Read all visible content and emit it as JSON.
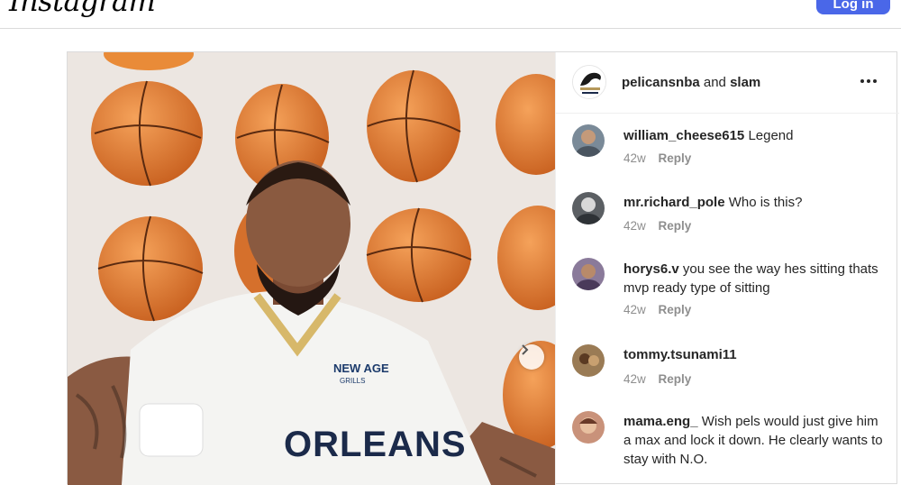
{
  "header": {
    "logo_text": "Instagram",
    "login_label": "Log in"
  },
  "post": {
    "author_a": "pelicansnba",
    "joiner": "and",
    "author_b": "slam",
    "photo": {
      "jersey_text": "ORLEANS",
      "sponsor_line1": "NEW AGE",
      "sponsor_line2": "GRILLS"
    },
    "comments": [
      {
        "user": "william_cheese615",
        "text": "Legend",
        "age": "42w",
        "reply": "Reply",
        "avatar_color": "#7a8a98"
      },
      {
        "user": "mr.richard_pole",
        "text": "Who is this?",
        "age": "42w",
        "reply": "Reply",
        "avatar_color": "#5b5f63"
      },
      {
        "user": "horys6.v",
        "text": "you see the way hes sitting thats mvp ready type of sitting",
        "age": "42w",
        "reply": "Reply",
        "avatar_color": "#8a7a9a"
      },
      {
        "user": "tommy.tsunami11",
        "text": "",
        "age": "42w",
        "reply": "Reply",
        "avatar_color": "#9a7b55"
      },
      {
        "user": "mama.eng_",
        "text": "Wish pels would just give him a max and lock it down. He clearly wants to stay with N.O.",
        "age": "",
        "reply": "",
        "avatar_color": "#c9927a"
      }
    ]
  },
  "colors": {
    "accent": "#4a67e8",
    "muted": "#8e8e8e",
    "ball": "#e8823a"
  }
}
